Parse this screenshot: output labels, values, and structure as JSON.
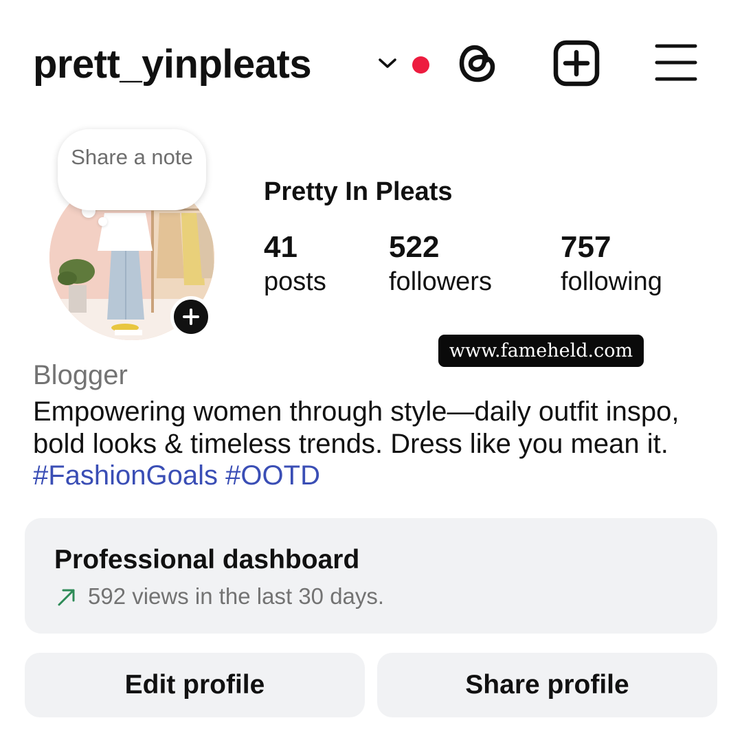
{
  "header": {
    "username": "prett_yinpleats",
    "notification_color": "#ed1c3f",
    "icons": [
      "chevron-down-icon",
      "threads-icon",
      "create-post-icon",
      "menu-icon"
    ]
  },
  "note": {
    "placeholder": "Share a note"
  },
  "profile": {
    "display_name": "Pretty In Pleats",
    "stats": [
      {
        "value": "41",
        "label": "posts"
      },
      {
        "value": "522",
        "label": "followers"
      },
      {
        "value": "757",
        "label": "following"
      }
    ],
    "category": "Blogger",
    "bio_text": "Empowering women through style—daily outfit inspo, bold looks & timeless trends. Dress like you mean it. ",
    "hashtags": [
      "#FashionGoals",
      "#OOTD"
    ],
    "hashtag_color": "#3a4eb5"
  },
  "watermark": "www.fameheld.com",
  "dashboard": {
    "title": "Professional dashboard",
    "subtitle": "592 views in the last 30 days.",
    "trend_color": "#2e8b57"
  },
  "actions": {
    "edit_label": "Edit profile",
    "share_label": "Share profile"
  }
}
